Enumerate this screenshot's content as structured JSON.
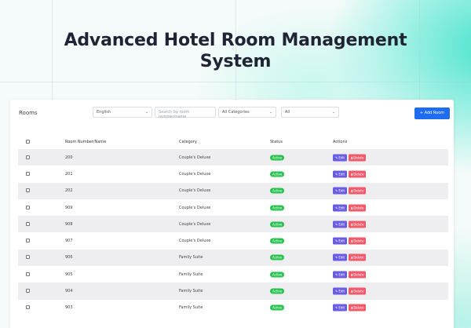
{
  "headline": {
    "line1": "Advanced Hotel Room Management",
    "line2": "System"
  },
  "toolbar": {
    "title": "Rooms",
    "language_select": "English",
    "search_placeholder": "Search by room number/name",
    "category_select": "All Categories",
    "status_select": "All",
    "add_button_label": "Add Room",
    "add_icon": "plus-icon"
  },
  "table": {
    "headers": {
      "room": "Room Number/Name",
      "category": "Category",
      "status": "Status",
      "actions": "Actions"
    },
    "action_labels": {
      "edit": "Edit",
      "delete": "Delete"
    },
    "rows": [
      {
        "room": "200",
        "category": "Couple's Deluxe",
        "status": "Active"
      },
      {
        "room": "201",
        "category": "Couple's Deluxe",
        "status": "Active"
      },
      {
        "room": "202",
        "category": "Couple's Deluxe",
        "status": "Active"
      },
      {
        "room": "909",
        "category": "Couple's Deluxe",
        "status": "Active"
      },
      {
        "room": "908",
        "category": "Couple's Deluxe",
        "status": "Active"
      },
      {
        "room": "907",
        "category": "Couple's Deluxe",
        "status": "Active"
      },
      {
        "room": "906",
        "category": "Family Suite",
        "status": "Active"
      },
      {
        "room": "905",
        "category": "Family Suite",
        "status": "Active"
      },
      {
        "room": "904",
        "category": "Family Suite",
        "status": "Active"
      },
      {
        "room": "903",
        "category": "Family Suite",
        "status": "Active"
      }
    ]
  },
  "colors": {
    "accent": "#1e6cf0",
    "active": "#28c24e",
    "edit": "#6a5ce0",
    "delete": "#ef5b6a"
  }
}
